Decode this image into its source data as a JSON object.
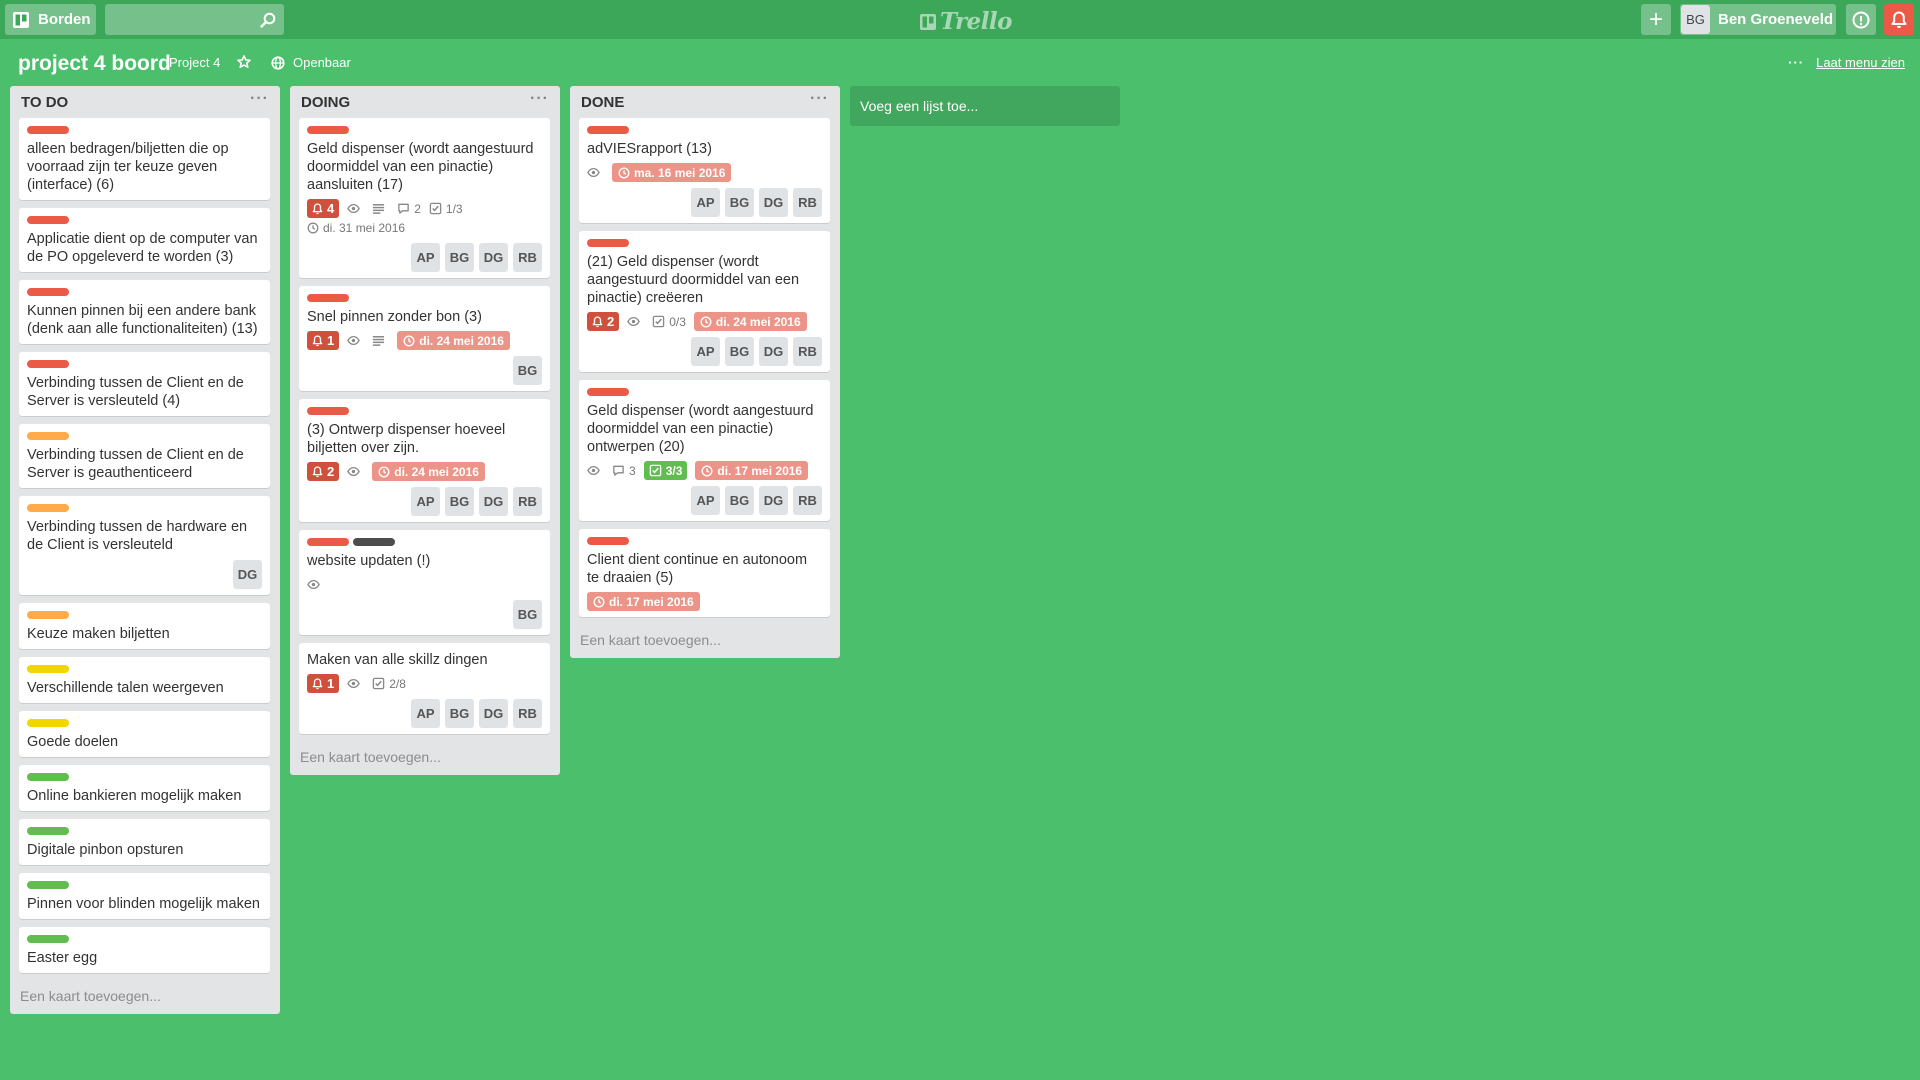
{
  "header": {
    "boards_label": "Borden",
    "search_value": "",
    "logo": "Trello",
    "user_initials": "BG",
    "user_name": "Ben Groeneveld"
  },
  "board": {
    "title": "project 4 boord",
    "team": "Project 4",
    "visibility": "Openbaar",
    "show_menu": "Laat menu zien"
  },
  "colors": {
    "red": "#eb5a46",
    "orange": "#ffab4a",
    "yellow": "#f2d600",
    "green": "#61bd4f",
    "black": "#4d4d4d",
    "board_bg": "#4bbf6b"
  },
  "lists": [
    {
      "title": "TO DO",
      "add_card": "Een kaart toevoegen...",
      "cards": [
        {
          "labels": [
            "red"
          ],
          "title": "alleen bedragen/biljetten die op voorraad zijn ter keuze geven (interface) (6)"
        },
        {
          "labels": [
            "red"
          ],
          "title": "Applicatie dient op de computer van de PO opgeleverd te worden (3)"
        },
        {
          "labels": [
            "red"
          ],
          "title": "Kunnen pinnen bij een andere bank (denk aan alle functionaliteiten) (13)"
        },
        {
          "labels": [
            "red"
          ],
          "title": "Verbinding tussen de Client en de Server is versleuteld (4)"
        },
        {
          "labels": [
            "orange"
          ],
          "title": "Verbinding tussen de Client en de Server is geauthenticeerd"
        },
        {
          "labels": [
            "orange"
          ],
          "title": "Verbinding tussen de hardware en de Client is versleuteld",
          "members": [
            "DG"
          ]
        },
        {
          "labels": [
            "orange"
          ],
          "title": "Keuze maken biljetten"
        },
        {
          "labels": [
            "yellow"
          ],
          "title": "Verschillende talen weergeven"
        },
        {
          "labels": [
            "yellow"
          ],
          "title": "Goede doelen"
        },
        {
          "labels": [
            "green"
          ],
          "title": "Online bankieren mogelijk maken"
        },
        {
          "labels": [
            "green"
          ],
          "title": "Digitale pinbon opsturen"
        },
        {
          "labels": [
            "green"
          ],
          "title": "Pinnen voor blinden mogelijk maken"
        },
        {
          "labels": [
            "green"
          ],
          "title": "Easter egg"
        }
      ]
    },
    {
      "title": "DOING",
      "add_card": "Een kaart toevoegen...",
      "cards": [
        {
          "labels": [
            "red"
          ],
          "title": "Geld dispenser (wordt aangestuurd doormiddel van een pinactie) aansluiten (17)",
          "badges": [
            {
              "type": "notif",
              "text": "4"
            },
            {
              "type": "watch"
            },
            {
              "type": "desc"
            },
            {
              "type": "comments",
              "text": "2"
            },
            {
              "type": "checklist",
              "text": "1/3"
            },
            {
              "type": "due-plain",
              "text": "di. 31 mei 2016"
            }
          ],
          "members": [
            "AP",
            "BG",
            "DG",
            "RB"
          ]
        },
        {
          "labels": [
            "red"
          ],
          "title": "Snel pinnen zonder bon (3)",
          "badges": [
            {
              "type": "notif",
              "text": "1"
            },
            {
              "type": "watch"
            },
            {
              "type": "desc"
            },
            {
              "type": "due",
              "text": "di. 24 mei 2016"
            }
          ],
          "members": [
            "BG"
          ]
        },
        {
          "labels": [
            "red"
          ],
          "title": "(3) Ontwerp dispenser hoeveel biljetten over zijn.",
          "badges": [
            {
              "type": "notif",
              "text": "2"
            },
            {
              "type": "watch"
            },
            {
              "type": "due",
              "text": "di. 24 mei 2016"
            }
          ],
          "members": [
            "AP",
            "BG",
            "DG",
            "RB"
          ]
        },
        {
          "labels": [
            "red",
            "black"
          ],
          "title": "website updaten (!)",
          "badges": [
            {
              "type": "watch"
            }
          ],
          "members": [
            "BG"
          ]
        },
        {
          "labels": [],
          "title": "Maken van alle skillz dingen",
          "badges": [
            {
              "type": "notif",
              "text": "1"
            },
            {
              "type": "watch"
            },
            {
              "type": "checklist",
              "text": "2/8"
            }
          ],
          "members": [
            "AP",
            "BG",
            "DG",
            "RB"
          ]
        }
      ]
    },
    {
      "title": "DONE",
      "add_card": "Een kaart toevoegen...",
      "cards": [
        {
          "labels": [
            "red"
          ],
          "title": "adVIESrapport (13)",
          "badges": [
            {
              "type": "watch"
            },
            {
              "type": "due",
              "text": "ma. 16 mei 2016"
            }
          ],
          "members": [
            "AP",
            "BG",
            "DG",
            "RB"
          ]
        },
        {
          "labels": [
            "red"
          ],
          "title": "(21) Geld dispenser (wordt aangestuurd doormiddel van een pinactie) creëeren",
          "badges": [
            {
              "type": "notif",
              "text": "2"
            },
            {
              "type": "watch"
            },
            {
              "type": "checklist",
              "text": "0/3"
            },
            {
              "type": "due",
              "text": "di. 24 mei 2016"
            }
          ],
          "members": [
            "AP",
            "BG",
            "DG",
            "RB"
          ]
        },
        {
          "labels": [
            "red"
          ],
          "title": "Geld dispenser (wordt aangestuurd doormiddel van een pinactie) ontwerpen (20)",
          "badges": [
            {
              "type": "watch"
            },
            {
              "type": "comments",
              "text": "3"
            },
            {
              "type": "checklist-done",
              "text": "3/3"
            },
            {
              "type": "due",
              "text": "di. 17 mei 2016"
            }
          ],
          "members": [
            "AP",
            "BG",
            "DG",
            "RB"
          ]
        },
        {
          "labels": [
            "red"
          ],
          "title": "Client dient continue en autonoom te draaien (5)",
          "badges": [
            {
              "type": "due",
              "text": "di. 17 mei 2016"
            }
          ]
        }
      ]
    }
  ],
  "add_list": "Voeg een lijst toe..."
}
